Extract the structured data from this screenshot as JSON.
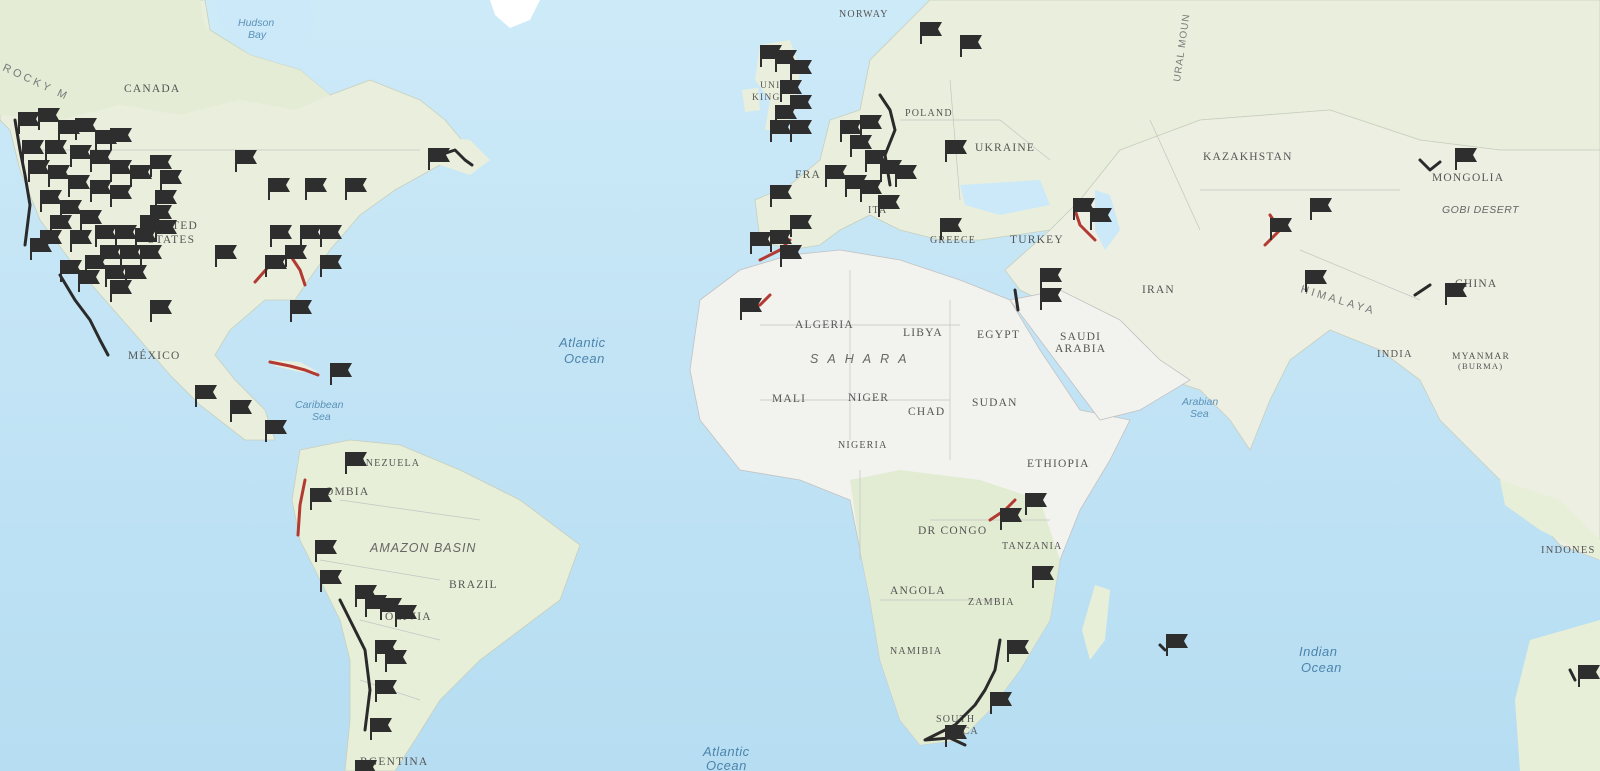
{
  "map": {
    "labels": {
      "canada": "CANADA",
      "hudson_bay_1": "Hudson",
      "hudson_bay_2": "Bay",
      "rocky": "ROCKY M",
      "united_states_1": "UNITED",
      "united_states_2": "STATES",
      "mexico": "MÉXICO",
      "caribbean_1": "Caribbean",
      "caribbean_2": "Sea",
      "venezuela": "VENEZUELA",
      "colombia": "OMBIA",
      "amazon": "AMAZON BASIN",
      "brazil": "BRAZIL",
      "bolivia": "OLIVIA",
      "argentina": "RGENTINA",
      "atlantic_1": "Atlantic",
      "atlantic_2": "Ocean",
      "atlantic_s_1": "Atlantic",
      "atlantic_s_2": "Ocean",
      "norway": "NORWAY",
      "uk_1": "UNIT",
      "uk_2": "KING",
      "poland": "POLAND",
      "ukraine": "UKRAINE",
      "france": "FRA",
      "italy": "ITA",
      "greece": "GREECE",
      "turkey": "TURKEY",
      "ural": "URAL MOUN",
      "kazakhstan": "KAZAKHSTAN",
      "mongolia": "MONGOLIA",
      "gobi": "GOBI DESERT",
      "iran": "IRAN",
      "china": "CHINA",
      "himalaya": "HIMALAYA",
      "india": "INDIA",
      "myanmar_1": "MYANMAR",
      "myanmar_2": "(BURMA)",
      "arabian_1": "Arabian",
      "arabian_2": "Sea",
      "saudi_1": "SAUDI",
      "saudi_2": "ARABIA",
      "egypt": "EGYPT",
      "libya": "LIBYA",
      "algeria": "ALGERIA",
      "sahara": "S A H A R A",
      "mali": "MALI",
      "niger": "NIGER",
      "chad": "CHAD",
      "sudan": "SUDAN",
      "nigeria": "NIGERIA",
      "ethiopia": "ETHIOPIA",
      "drcongo": "DR CONGO",
      "tanzania": "TANZANIA",
      "angola": "ANGOLA",
      "zambia": "ZAMBIA",
      "namibia": "NAMIBIA",
      "south_africa_1": "SOUTH",
      "south_africa_2": "ICA",
      "indian_1": "Indian",
      "indian_2": "Ocean",
      "indonesia": "INDONES"
    },
    "colors": {
      "ocean": "#bfe3f5",
      "land": "#eef2e4",
      "land_green": "#dde9c9",
      "desert": "#f2f1ec",
      "border": "#b7b7b7",
      "marker": "#2e2e2e",
      "route_red": "#b23a32",
      "route_dark": "#2a2a2a"
    },
    "marker_icon": "flag-icon"
  }
}
